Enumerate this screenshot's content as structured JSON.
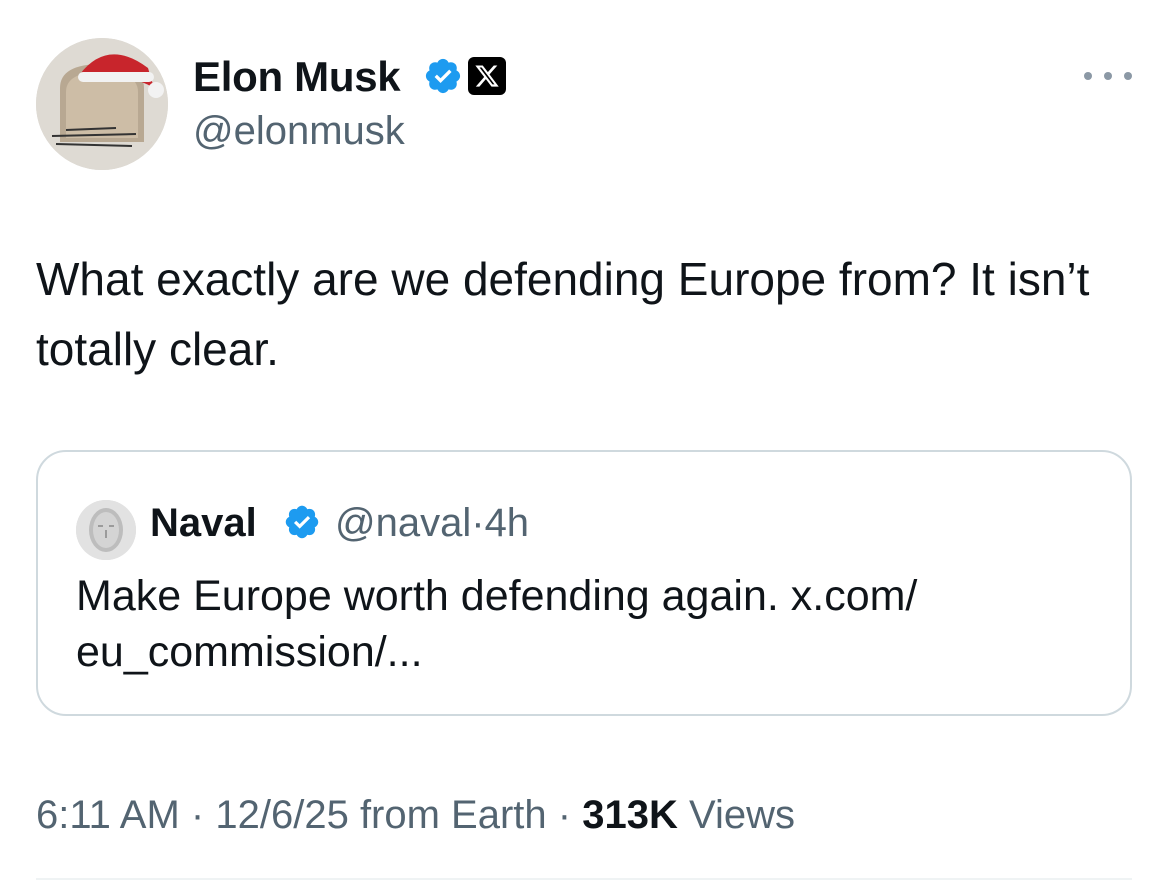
{
  "author": {
    "name": "Elon Musk",
    "handle": "@elonmusk",
    "verified_color": "#1d9bf0",
    "avatar_icon": "elon-avatar",
    "affiliate_icon": "x-logo-icon"
  },
  "tweet": {
    "text": "What exactly are we defending Europe from? It isn’t totally clear."
  },
  "quoted": {
    "name": "Naval",
    "handle": "@naval",
    "separator": "·",
    "age": "4h",
    "text": "Make Europe worth defending again. x.com/\neu_commission/..."
  },
  "meta": {
    "time": "6:11 AM",
    "sep1": "·",
    "date": "12/6/25 from Earth",
    "sep2": "·",
    "views_count": "313K",
    "views_label": "Views"
  },
  "colors": {
    "text": "#0f1419",
    "secondary": "#536471",
    "border": "#cfd9de",
    "verified": "#1d9bf0"
  }
}
